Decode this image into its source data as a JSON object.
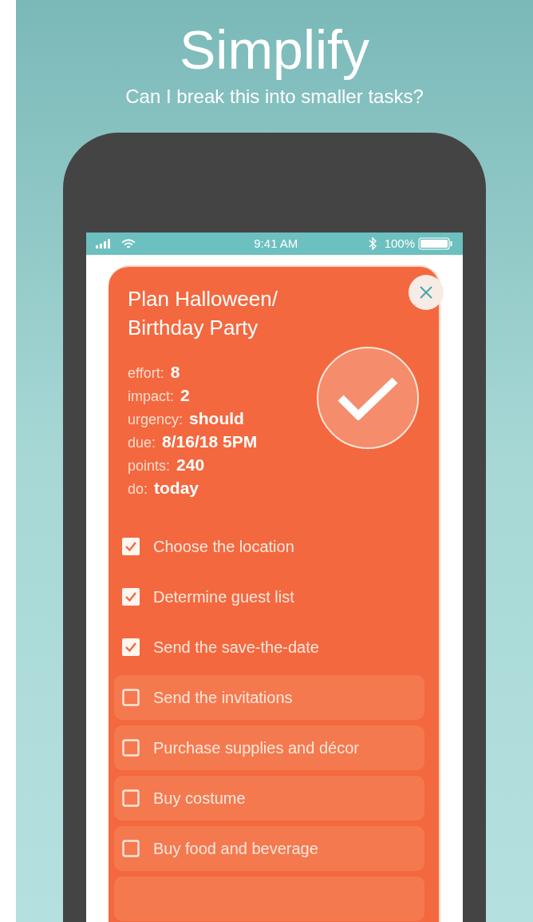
{
  "header": {
    "title": "Simplify",
    "subtitle": "Can I break this into smaller tasks?"
  },
  "status_bar": {
    "time": "9:41 AM",
    "battery": "100%"
  },
  "task": {
    "title_lines": [
      "Plan Halloween/",
      "Birthday Party"
    ],
    "fields": [
      {
        "label": "effort:",
        "value": "8"
      },
      {
        "label": "impact:",
        "value": "2"
      },
      {
        "label": "urgency:",
        "value": "should"
      },
      {
        "label": "due:",
        "value": "8/16/18 5PM"
      },
      {
        "label": "points:",
        "value": "240"
      },
      {
        "label": "do:",
        "value": "today"
      }
    ],
    "completed": true,
    "subtasks": [
      {
        "label": "Choose the location",
        "checked": true
      },
      {
        "label": "Determine guest list",
        "checked": true
      },
      {
        "label": "Send the save-the-date",
        "checked": true
      },
      {
        "label": "Send the invitations",
        "checked": false
      },
      {
        "label": "Purchase supplies and décor",
        "checked": false
      },
      {
        "label": "Buy costume",
        "checked": false
      },
      {
        "label": "Buy food and beverage",
        "checked": false
      }
    ]
  }
}
